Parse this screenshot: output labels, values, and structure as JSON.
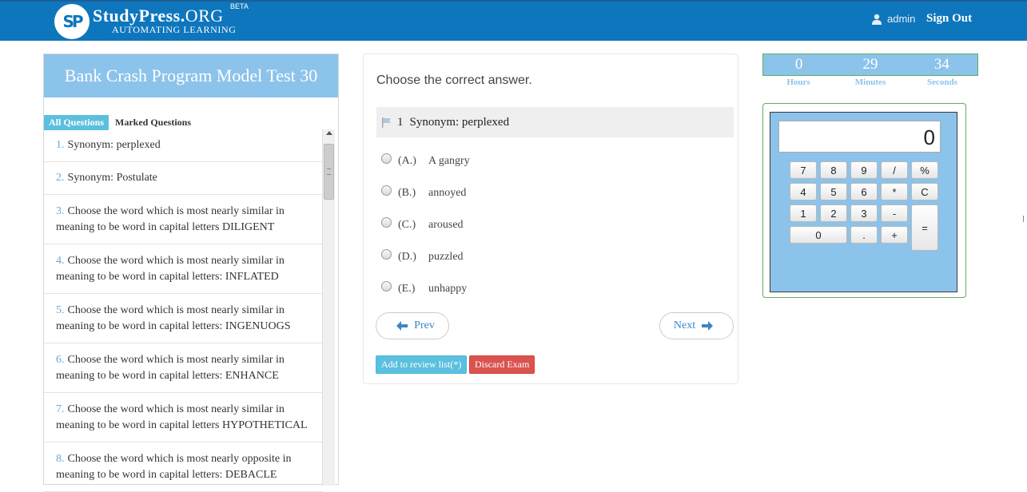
{
  "header": {
    "logo_initials": "SP",
    "brand_main": "StudyPress.",
    "brand_suffix": "ORG",
    "beta": "BETA",
    "tagline": "AUTOMATING LEARNING",
    "user": "admin",
    "signout": "Sign Out"
  },
  "sidebar": {
    "title": "Bank Crash Program Model Test 30",
    "tab_all": "All Questions",
    "tab_marked": "Marked Questions",
    "questions": [
      {
        "num": "1.",
        "line1": "Synonym: perplexed",
        "line2": ""
      },
      {
        "num": "2.",
        "line1": "Synonym: Postulate",
        "line2": ""
      },
      {
        "num": "3.",
        "line1": "Choose the word which is most nearly similar in",
        "line2": "meaning to be word in capital letters DILIGENT"
      },
      {
        "num": "4.",
        "line1": "Choose the word which is most nearly similar in",
        "line2": "meaning to be word in capital letters: INFLATED"
      },
      {
        "num": "5.",
        "line1": "Choose the word which is most nearly similar in",
        "line2": "meaning to be word in capital letters: INGENUOGS"
      },
      {
        "num": "6.",
        "line1": "Choose the word which is most nearly similar in",
        "line2": "meaning to be word in capital letters: ENHANCE"
      },
      {
        "num": "7.",
        "line1": "Choose the word which is most nearly similar in",
        "line2": "meaning to be word in capital letters HYPOTHETICAL"
      },
      {
        "num": "8.",
        "line1": "Choose the word which is most nearly opposite in",
        "line2": "meaning to be word in capital letters: DEBACLE"
      }
    ]
  },
  "question": {
    "instruction": "Choose the correct answer.",
    "number": "1",
    "text": "Synonym: perplexed",
    "options": [
      {
        "letter": "(A.)",
        "text": "A gangry"
      },
      {
        "letter": "(B.)",
        "text": "annoyed"
      },
      {
        "letter": "(C.)",
        "text": "aroused"
      },
      {
        "letter": "(D.)",
        "text": "puzzled"
      },
      {
        "letter": "(E.)",
        "text": "unhappy"
      }
    ],
    "prev": "Prev",
    "next": "Next",
    "review": "Add to review list(*)",
    "discard": "Discard Exam"
  },
  "timer": {
    "hours": "0",
    "minutes": "29",
    "seconds": "34",
    "hours_label": "Hours",
    "minutes_label": "Minutes",
    "seconds_label": "Seconds"
  },
  "calculator": {
    "display": "0",
    "keys": [
      "7",
      "8",
      "9",
      "/",
      "%",
      "4",
      "5",
      "6",
      "*",
      "C",
      "1",
      "2",
      "3",
      "-",
      "=",
      "0",
      ".",
      "+"
    ]
  },
  "colors": {
    "header_bg": "#0e76bd",
    "panel_blue": "#8cc3ea",
    "info": "#5bc0de",
    "danger": "#d9534f"
  }
}
